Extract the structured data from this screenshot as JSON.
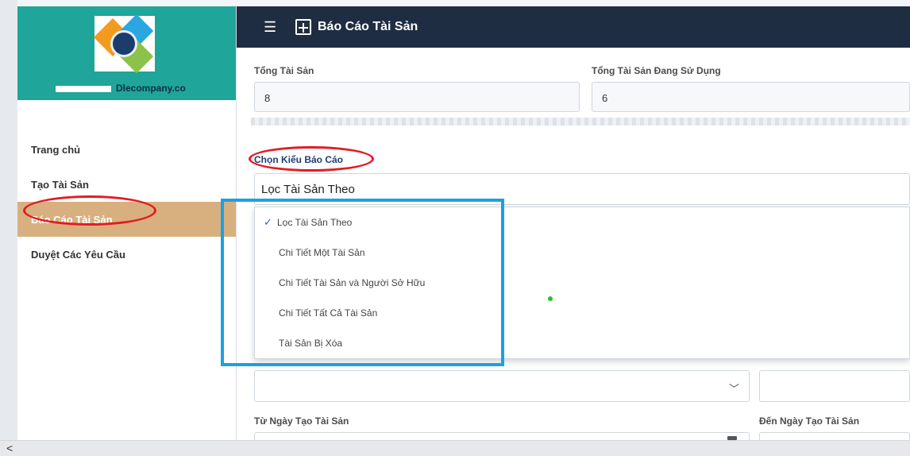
{
  "sidebar": {
    "account_suffix": "Dlecompany.co",
    "items": [
      {
        "label": "Trang chủ"
      },
      {
        "label": "Tạo Tài Sản"
      },
      {
        "label": "Báo Cáo Tài Sản"
      },
      {
        "label": "Duyệt Các Yêu Cầu"
      }
    ]
  },
  "header": {
    "title": "Báo Cáo Tài Sản"
  },
  "stats": {
    "total_label": "Tổng Tài Sản",
    "total_value": "8",
    "in_use_label": "Tổng Tài Sản Đang Sử Dụng",
    "in_use_value": "6"
  },
  "report": {
    "type_label": "Chọn Kiểu Báo Cáo",
    "selected_value": "Lọc Tài Sản Theo",
    "options": [
      {
        "label": "Lọc Tài Sản Theo",
        "selected": true
      },
      {
        "label": "Chi Tiết Một Tài Sản",
        "selected": false
      },
      {
        "label": "Chi Tiết Tài Sản và Người Sở Hữu",
        "selected": false
      },
      {
        "label": "Chi Tiết Tất Cả Tài Sản",
        "selected": false
      },
      {
        "label": "Tài Sản Bị Xóa",
        "selected": false
      }
    ]
  },
  "dates": {
    "from_label": "Từ Ngày Tạo Tài Sản",
    "to_label": "Đến Ngày Tạo Tài Sản"
  },
  "colors": {
    "sidebar_brand": "#1fa59a",
    "topbar": "#1f2d42",
    "active_nav": "#d8b07f",
    "annotation_red": "#e31b23",
    "annotation_blue": "#1ba1e2"
  },
  "icons": [
    "hamburger-icon",
    "report-icon",
    "checkmark-icon",
    "chevron-down-icon",
    "calendar-icon",
    "scroll-left-icon"
  ]
}
